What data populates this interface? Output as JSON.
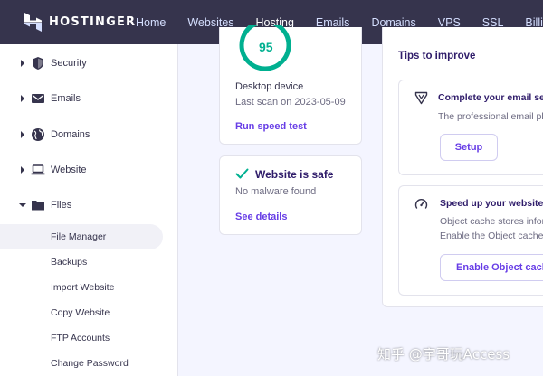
{
  "brand": {
    "name": "HOSTINGER"
  },
  "nav": {
    "items": [
      {
        "label": "Home"
      },
      {
        "label": "Websites"
      },
      {
        "label": "Hosting",
        "active": true
      },
      {
        "label": "Emails"
      },
      {
        "label": "Domains"
      },
      {
        "label": "VPS"
      },
      {
        "label": "SSL"
      },
      {
        "label": "Billing"
      }
    ]
  },
  "sidebar": {
    "sections": [
      {
        "label": "Security",
        "icon": "shield-icon",
        "expanded": false
      },
      {
        "label": "Emails",
        "icon": "envelope-icon",
        "expanded": false
      },
      {
        "label": "Domains",
        "icon": "globe-icon",
        "expanded": false
      },
      {
        "label": "Website",
        "icon": "laptop-icon",
        "expanded": false
      },
      {
        "label": "Files",
        "icon": "folder-icon",
        "expanded": true
      }
    ],
    "files_items": [
      {
        "label": "File Manager",
        "active": true
      },
      {
        "label": "Backups"
      },
      {
        "label": "Import Website"
      },
      {
        "label": "Copy Website"
      },
      {
        "label": "FTP Accounts"
      },
      {
        "label": "Change Password"
      }
    ]
  },
  "speed_card": {
    "score": "95",
    "score_fraction": 0.95,
    "device": "Desktop device",
    "last_scan": "Last scan on 2023-05-09",
    "action": "Run speed test"
  },
  "safety_card": {
    "title": "Website is safe",
    "status": "No malware found",
    "action": "See details"
  },
  "tips": {
    "heading": "Tips to improve",
    "items": [
      {
        "title": "Complete your email setu",
        "desc": "The professional email pla",
        "button": "Setup",
        "icon": "badge-icon"
      },
      {
        "title": "Speed up your website",
        "desc_1": "Object cache stores infor",
        "desc_2": "Enable the Object cache",
        "button": "Enable Object cache",
        "icon": "speedometer-icon"
      }
    ]
  },
  "watermark": "知乎 @宇哥玩Access",
  "colors": {
    "topbar": "#36344d",
    "accent": "#673de6",
    "score_ring": "#00b090",
    "page_bg": "#f4f5ff"
  }
}
